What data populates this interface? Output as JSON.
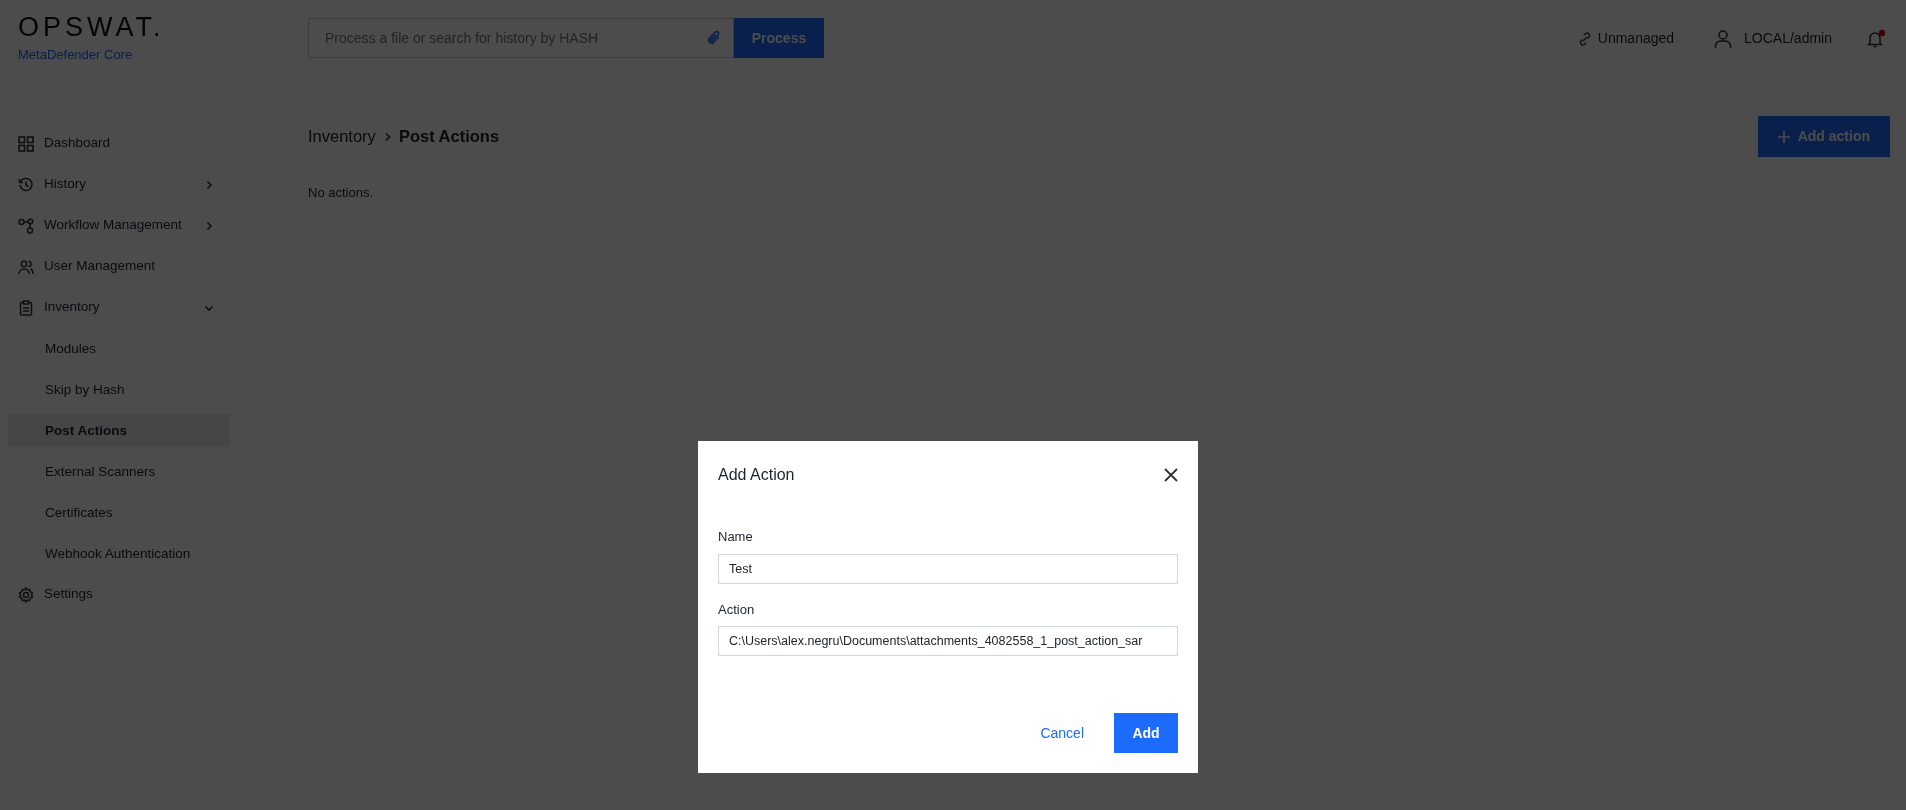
{
  "header": {
    "logo": "OPSWAT.",
    "product": "MetaDefender Core",
    "search": {
      "placeholder": "Process a file or search for history by HASH"
    },
    "process_button": "Process",
    "status": "Unmanaged",
    "user": "LOCAL/admin",
    "notifications": {
      "unread": true
    }
  },
  "sidebar": {
    "items": [
      {
        "label": "Dashboard",
        "kind": "link",
        "selected": false
      },
      {
        "label": "History",
        "kind": "group",
        "expanded": false,
        "selected": false
      },
      {
        "label": "Workflow Management",
        "kind": "group",
        "expanded": false,
        "selected": false
      },
      {
        "label": "User Management",
        "kind": "link",
        "selected": false
      },
      {
        "label": "Inventory",
        "kind": "group",
        "expanded": true,
        "selected": false,
        "children": [
          {
            "label": "Modules",
            "selected": false
          },
          {
            "label": "Skip by Hash",
            "selected": false
          },
          {
            "label": "Post Actions",
            "selected": true
          },
          {
            "label": "External Scanners",
            "selected": false
          },
          {
            "label": "Certificates",
            "selected": false
          },
          {
            "label": "Webhook Authentication",
            "selected": false
          }
        ]
      },
      {
        "label": "Settings",
        "kind": "link",
        "selected": false
      }
    ]
  },
  "breadcrumb": [
    "Inventory",
    "Post Actions"
  ],
  "add_button": "Add action",
  "empty_message": "No actions.",
  "dialog": {
    "title": "Add Action",
    "fields": [
      {
        "label": "Name",
        "value": "Test"
      },
      {
        "label": "Action",
        "value": "C:\\Users\\alex.negru\\Documents\\attachments_4082558_1_post_action_sar"
      }
    ],
    "cancel": "Cancel",
    "confirm": "Add"
  }
}
